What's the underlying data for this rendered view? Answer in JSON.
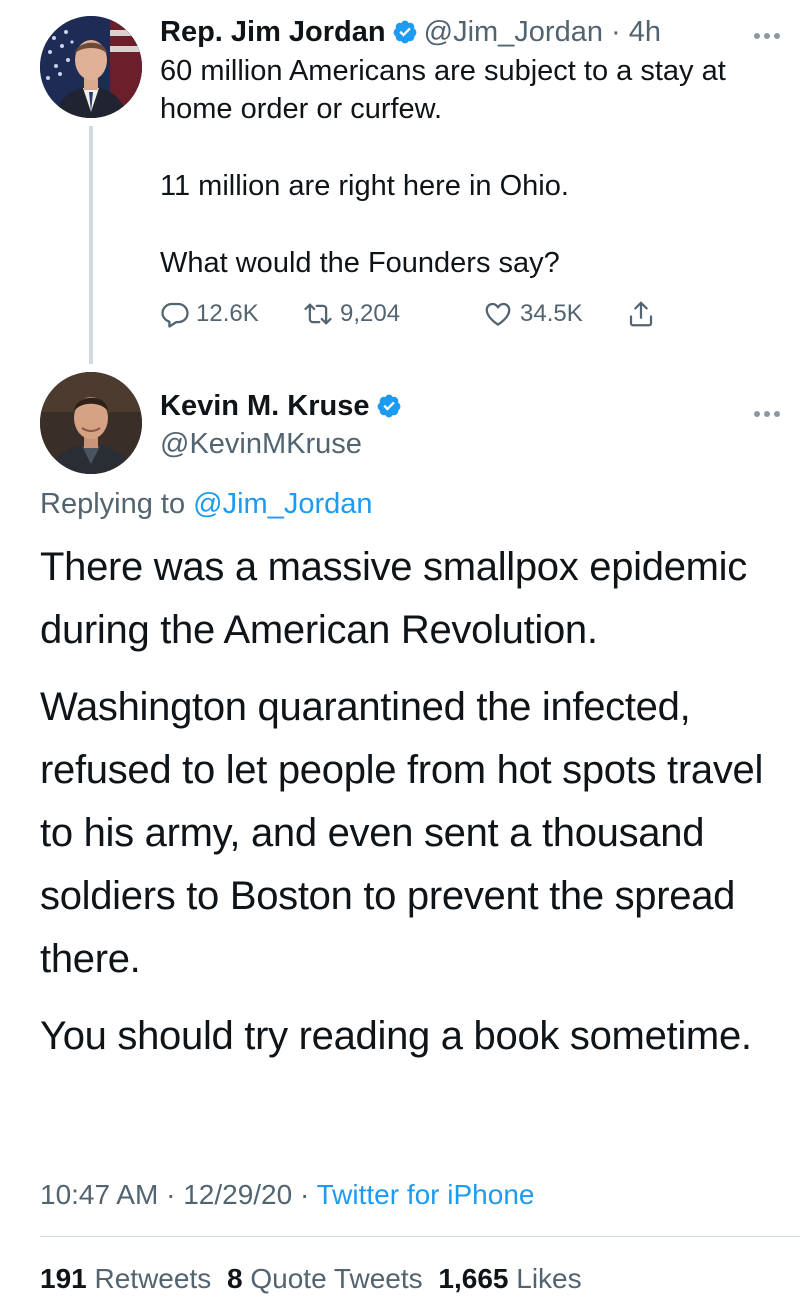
{
  "parent_tweet": {
    "author_name": "Rep. Jim Jordan",
    "handle": "@Jim_Jordan",
    "separator": "·",
    "time": "4h",
    "text_lines": [
      "60 million Americans are subject to a stay at home order or curfew.",
      "11 million are right here in Ohio.",
      "What would the Founders say?"
    ],
    "actions": {
      "replies": "12.6K",
      "retweets": "9,204",
      "likes": "34.5K"
    }
  },
  "main_tweet": {
    "author_name": "Kevin M. Kruse",
    "handle": "@KevinMKruse",
    "replying_prefix": "Replying to",
    "replying_to": "@Jim_Jordan",
    "paragraphs": [
      "There was a massive smallpox epidemic during the American Revolution.",
      "Washington quarantined the infected, refused to let people from hot spots travel to his army, and even sent a thousand soldiers to Boston to prevent the spread there.",
      "You should try reading a book sometime."
    ],
    "meta": {
      "time": "10:47 AM",
      "date": "12/29/20",
      "separator": "·",
      "source": "Twitter for iPhone"
    },
    "stats": {
      "retweets_count": "191",
      "retweets_label": "Retweets",
      "quotes_count": "8",
      "quotes_label": "Quote Tweets",
      "likes_count": "1,665",
      "likes_label": "Likes"
    }
  },
  "colors": {
    "text": "#0f1419",
    "secondary": "#536471",
    "accent": "#1d9bf0",
    "divider": "#cfd9de"
  },
  "icons": [
    "verified-badge-icon",
    "more-icon",
    "reply-icon",
    "retweet-icon",
    "like-icon",
    "share-icon"
  ]
}
